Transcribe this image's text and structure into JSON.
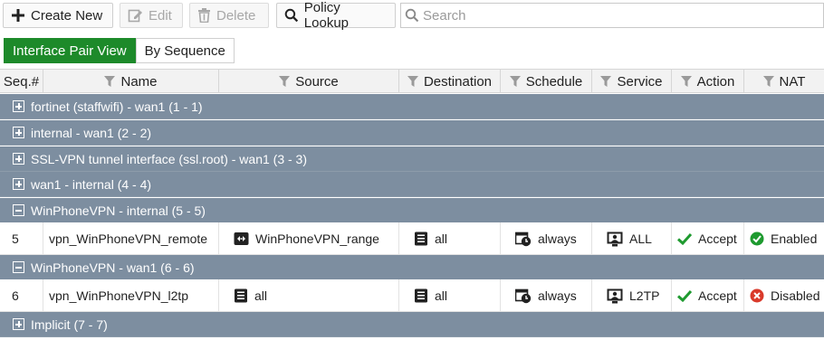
{
  "toolbar": {
    "create_label": "Create New",
    "edit_label": "Edit",
    "delete_label": "Delete",
    "lookup_label": "Policy Lookup",
    "search_placeholder": "Search"
  },
  "views": {
    "interface_pair": "Interface Pair View",
    "by_sequence": "By Sequence"
  },
  "columns": {
    "seq": "Seq.#",
    "name": "Name",
    "source": "Source",
    "destination": "Destination",
    "schedule": "Schedule",
    "service": "Service",
    "action": "Action",
    "nat": "NAT"
  },
  "groups": [
    {
      "label": "fortinet (staffwifi) - wan1 (1 - 1)",
      "expanded": false
    },
    {
      "label": "internal - wan1 (2 - 2)",
      "expanded": false
    },
    {
      "label": "SSL-VPN tunnel interface (ssl.root) - wan1 (3 - 3)",
      "expanded": false
    },
    {
      "label": "wan1 - internal (4 - 4)",
      "expanded": false
    },
    {
      "label": "WinPhoneVPN - internal (5 - 5)",
      "expanded": true
    },
    {
      "label": "WinPhoneVPN - wan1 (6 - 6)",
      "expanded": true
    },
    {
      "label": "Implicit (7 - 7)",
      "expanded": false
    }
  ],
  "rows": [
    {
      "seq": "5",
      "name": "vpn_WinPhoneVPN_remote",
      "source": "WinPhoneVPN_range",
      "source_icon": "address-range-icon",
      "destination": "all",
      "schedule": "always",
      "service": "ALL",
      "action": "Accept",
      "nat": "Enabled",
      "nat_status": "enabled"
    },
    {
      "seq": "6",
      "name": "vpn_WinPhoneVPN_l2tp",
      "source": "all",
      "source_icon": "address-icon",
      "destination": "all",
      "schedule": "always",
      "service": "L2TP",
      "action": "Accept",
      "nat": "Disabled",
      "nat_status": "disabled"
    }
  ],
  "colors": {
    "active_tab": "#1d8a2a",
    "group_bg": "#7d8ea0",
    "accept_check": "#1e9a2f",
    "enabled_icon": "#1e9a2f",
    "disabled_icon": "#d93a2b"
  }
}
